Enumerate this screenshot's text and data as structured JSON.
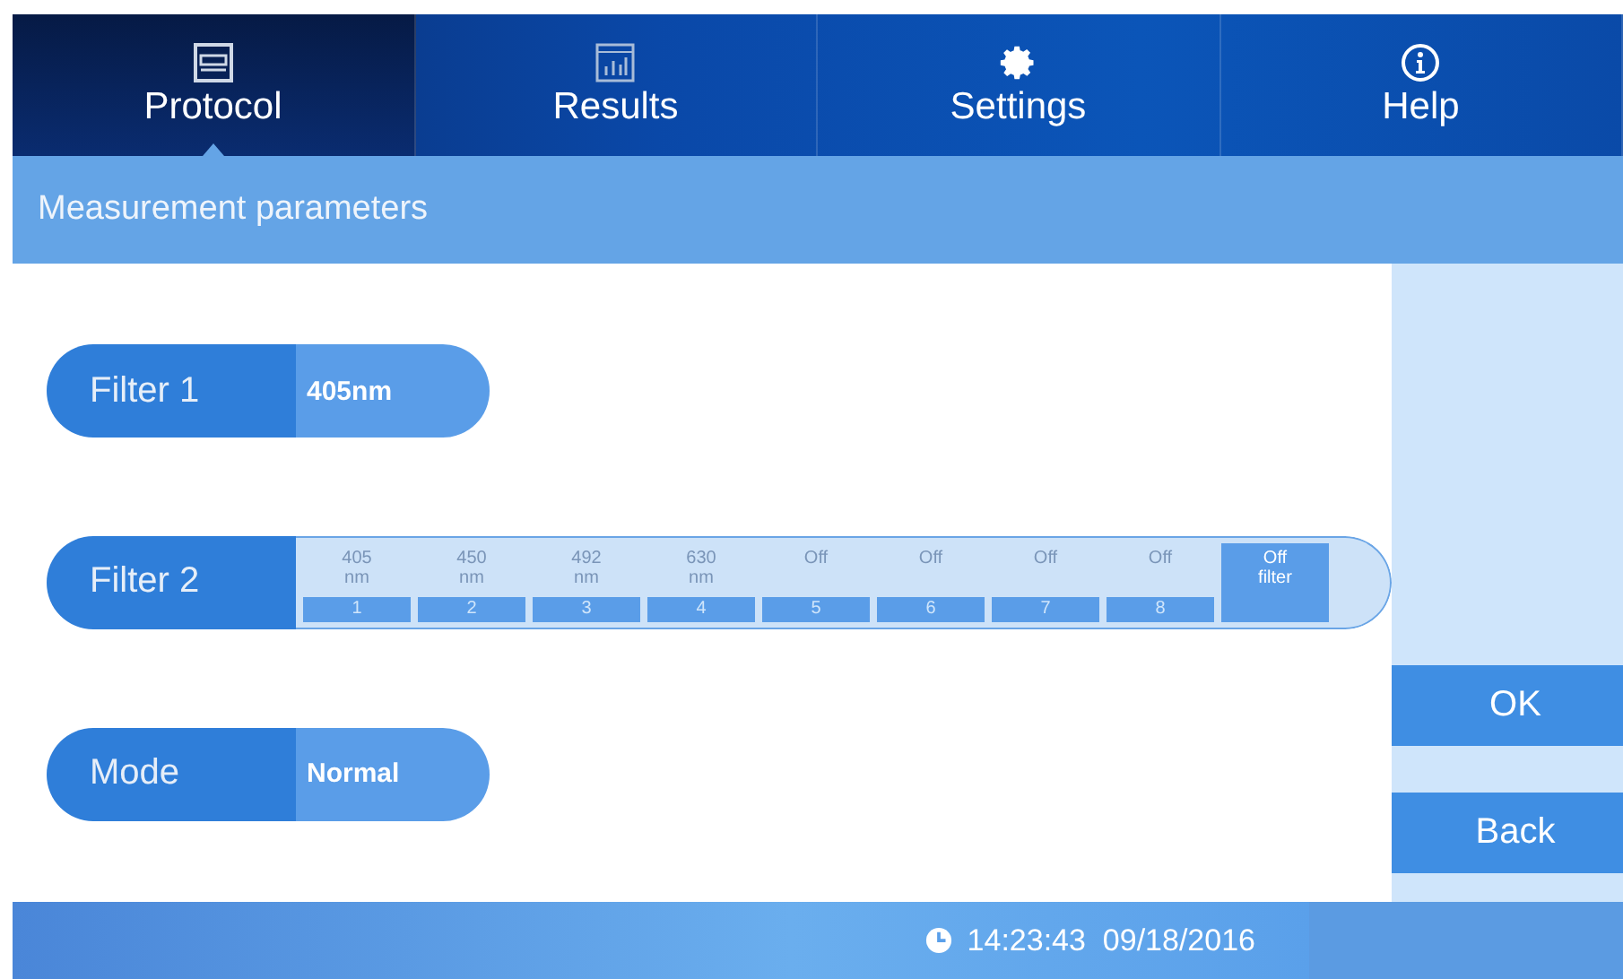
{
  "tabs": [
    {
      "label": "Protocol",
      "selected": true
    },
    {
      "label": "Results",
      "selected": false
    },
    {
      "label": "Settings",
      "selected": false
    },
    {
      "label": "Help",
      "selected": false
    }
  ],
  "section_title": "Measurement parameters",
  "rows": [
    {
      "kind": "value",
      "label": "Filter 1",
      "value": "405nm"
    },
    {
      "kind": "options",
      "label": "Filter 2",
      "options": [
        {
          "text": "405",
          "unit": "nm",
          "number": "1",
          "selected": false
        },
        {
          "text": "450",
          "unit": "nm",
          "number": "2",
          "selected": false
        },
        {
          "text": "492",
          "unit": "nm",
          "number": "3",
          "selected": false
        },
        {
          "text": "630",
          "unit": "nm",
          "number": "4",
          "selected": false
        },
        {
          "text": "Off",
          "number": "5",
          "selected": false
        },
        {
          "text": "Off",
          "number": "6",
          "selected": false
        },
        {
          "text": "Off",
          "number": "7",
          "selected": false
        },
        {
          "text": "Off",
          "number": "8",
          "selected": false
        },
        {
          "text": "Off",
          "unit": "filter",
          "selected": true
        }
      ]
    },
    {
      "kind": "value",
      "label": "Mode",
      "value": "Normal"
    }
  ],
  "buttons": [
    "OK",
    "Back"
  ],
  "status_bar": {
    "time": "14:23:43",
    "date": "09/18/2016"
  }
}
